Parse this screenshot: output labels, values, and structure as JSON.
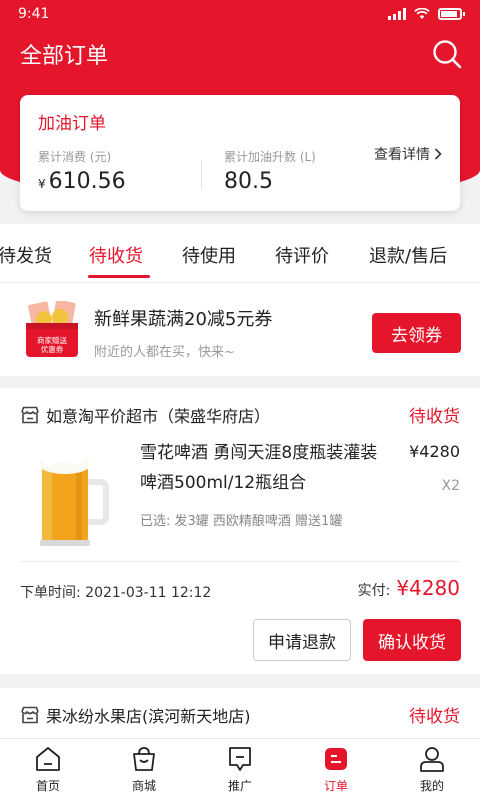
{
  "status": {
    "time": "9:41"
  },
  "header": {
    "title": "全部订单"
  },
  "summary": {
    "title": "加油订单",
    "spend_label": "累计消费 (元)",
    "spend_currency": "¥",
    "spend_value": "610.56",
    "liters_label": "累计加油升数 (L)",
    "liters_value": "80.5",
    "detail_link": "查看详情"
  },
  "tabs": [
    "待发货",
    "待收货",
    "待使用",
    "待评价",
    "退款/售后"
  ],
  "active_tab": "待收货",
  "coupon": {
    "title": "新鲜果蔬满20减5元券",
    "subtitle": "附近的人都在买，快来~",
    "button": "去领券",
    "image_text_1": "商家赠送",
    "image_text_2": "优惠券"
  },
  "orders": [
    {
      "shop": "如意淘平价超市（荣盛华府店）",
      "status": "待收货",
      "product_name": "雪花啤酒 勇闯天涯8度瓶装灌装 啤酒500ml/12瓶组合",
      "price": "¥4280",
      "qty": "X2",
      "spec": "已选: 发3罐 西欧精酿啤酒 赠送1罐",
      "time": "下单时间: 2021-03-11 12:12",
      "paid_label": "实付:",
      "paid_value": "¥4280",
      "refund_button": "申请退款",
      "confirm_button": "确认收货"
    },
    {
      "shop": "果冰纷水果店(滨河新天地店)",
      "status": "待收货"
    }
  ],
  "bottom_nav": [
    {
      "label": "首页",
      "icon": "home-icon"
    },
    {
      "label": "商城",
      "icon": "shop-bag-icon"
    },
    {
      "label": "推广",
      "icon": "promote-icon"
    },
    {
      "label": "订单",
      "icon": "order-icon"
    },
    {
      "label": "我的",
      "icon": "profile-icon"
    }
  ],
  "colors": {
    "accent": "#e5162c",
    "background": "#f2f2f2"
  }
}
